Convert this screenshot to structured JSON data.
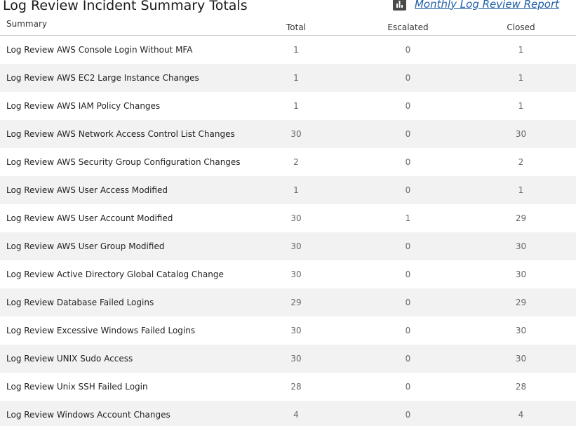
{
  "header": {
    "title": "Log Review Incident Summary Totals",
    "report_link": "Monthly Log Review Report",
    "report_icon": "bar-chart-icon"
  },
  "table": {
    "columns": {
      "summary": "Summary",
      "total": "Total",
      "escalated": "Escalated",
      "closed": "Closed"
    },
    "rows": [
      {
        "summary": "Log Review AWS Console Login Without MFA",
        "total": "1",
        "escalated": "0",
        "closed": "1"
      },
      {
        "summary": "Log Review AWS EC2 Large Instance Changes",
        "total": "1",
        "escalated": "0",
        "closed": "1"
      },
      {
        "summary": "Log Review AWS IAM Policy Changes",
        "total": "1",
        "escalated": "0",
        "closed": "1"
      },
      {
        "summary": "Log Review AWS Network Access Control List Changes",
        "total": "30",
        "escalated": "0",
        "closed": "30"
      },
      {
        "summary": "Log Review AWS Security Group Configuration Changes",
        "total": "2",
        "escalated": "0",
        "closed": "2"
      },
      {
        "summary": "Log Review AWS User Access Modified",
        "total": "1",
        "escalated": "0",
        "closed": "1"
      },
      {
        "summary": "Log Review AWS User Account Modified",
        "total": "30",
        "escalated": "1",
        "closed": "29"
      },
      {
        "summary": "Log Review AWS User Group Modified",
        "total": "30",
        "escalated": "0",
        "closed": "30"
      },
      {
        "summary": "Log Review Active Directory Global Catalog Change",
        "total": "30",
        "escalated": "0",
        "closed": "30"
      },
      {
        "summary": "Log Review Database Failed Logins",
        "total": "29",
        "escalated": "0",
        "closed": "29"
      },
      {
        "summary": "Log Review Excessive Windows Failed Logins",
        "total": "30",
        "escalated": "0",
        "closed": "30"
      },
      {
        "summary": "Log Review UNIX Sudo Access",
        "total": "30",
        "escalated": "0",
        "closed": "30"
      },
      {
        "summary": "Log Review Unix SSH Failed Login",
        "total": "28",
        "escalated": "0",
        "closed": "28"
      },
      {
        "summary": "Log Review Windows Account Changes",
        "total": "4",
        "escalated": "0",
        "closed": "4"
      }
    ]
  }
}
